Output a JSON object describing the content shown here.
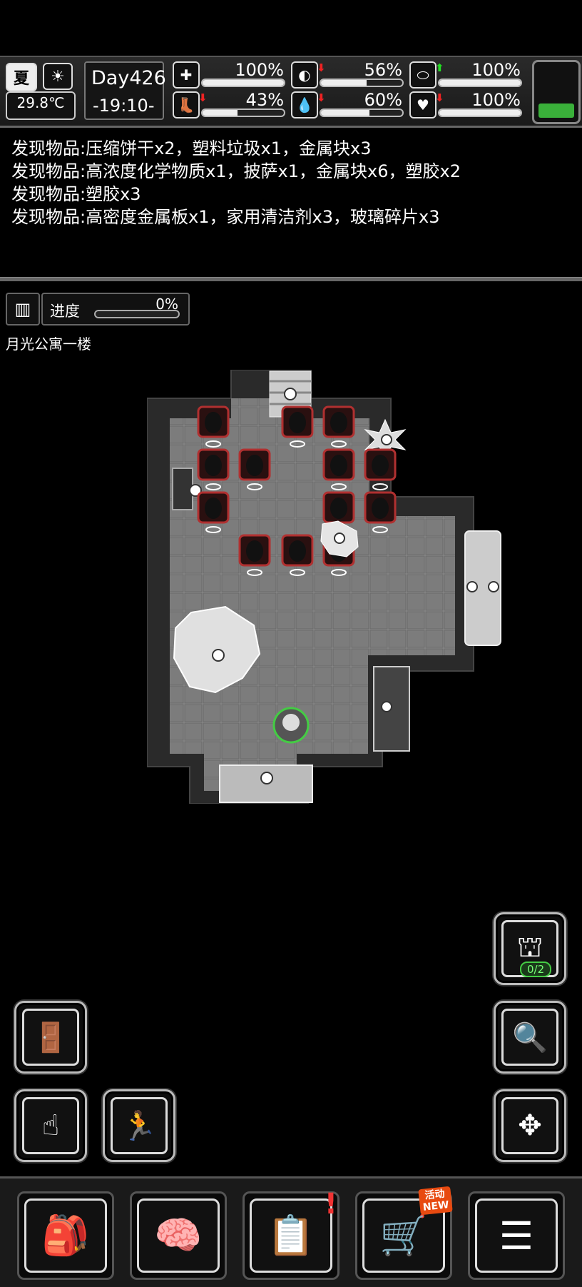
{
  "status": {
    "season": "夏",
    "temperature": "29.8℃",
    "day": "Day426",
    "time": "-19:10-",
    "stats": [
      {
        "name": "health",
        "value": "100%",
        "level": 1.0,
        "arrow": ""
      },
      {
        "name": "hunger",
        "value": "56%",
        "level": 0.56,
        "arrow": "down"
      },
      {
        "name": "mood",
        "value": "100%",
        "level": 1.0,
        "arrow": "up"
      },
      {
        "name": "stamina",
        "value": "43%",
        "level": 0.43,
        "arrow": "down"
      },
      {
        "name": "thirst",
        "value": "60%",
        "level": 0.6,
        "arrow": "down"
      },
      {
        "name": "heart",
        "value": "100%",
        "level": 1.0,
        "arrow": "down"
      }
    ]
  },
  "log": [
    "发现物品:压缩饼干x2，塑料垃圾x1，金属块x3",
    "发现物品:高浓度化学物质x1，披萨x1，金属块x6，塑胶x2",
    "发现物品:塑胶x3",
    "发现物品:高密度金属板x1，家用清洁剂x3，玻璃碎片x3"
  ],
  "progress": {
    "label": "进度",
    "value": "0%"
  },
  "location": "月光公寓一楼",
  "turret_count": "0/2",
  "nav_badge": "活动\nNEW",
  "colors": {
    "accent_green": "#3ab03a",
    "arrow_red": "#e22",
    "arrow_green": "#2d2"
  }
}
